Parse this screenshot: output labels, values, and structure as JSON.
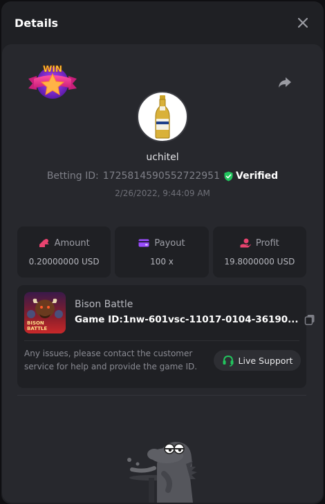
{
  "header": {
    "title": "Details"
  },
  "player": {
    "username": "uchitel",
    "betting_id_label": "Betting ID:",
    "betting_id": "1725814590552722951",
    "verified_label": "Verified",
    "datetime": "2/26/2022, 9:44:09 AM"
  },
  "badge": {
    "text": "WIN"
  },
  "stats": [
    {
      "label": "Amount",
      "value": "0.20000000 USD",
      "icon": "amount-icon",
      "color": "#e8436f"
    },
    {
      "label": "Payout",
      "value": "100 x",
      "icon": "payout-card-icon",
      "color": "#9b4dff"
    },
    {
      "label": "Profit",
      "value": "19.8000000 USD",
      "icon": "profit-hand-icon",
      "color": "#e8436f"
    }
  ],
  "game": {
    "name": "Bison Battle",
    "id_label": "Game ID:",
    "id_value": "1nw-601vsc-11017-0104-36190...",
    "thumb_text": "BISON\nBATTLE",
    "issue_text": "Any issues, please contact the customer service for help and provide the game ID.",
    "support_label": "Live Support"
  },
  "colors": {
    "accent_green": "#22c55e",
    "accent_pink": "#e8436f",
    "accent_purple": "#9b4dff",
    "background": "#1f2024",
    "panel": "#27282d"
  }
}
